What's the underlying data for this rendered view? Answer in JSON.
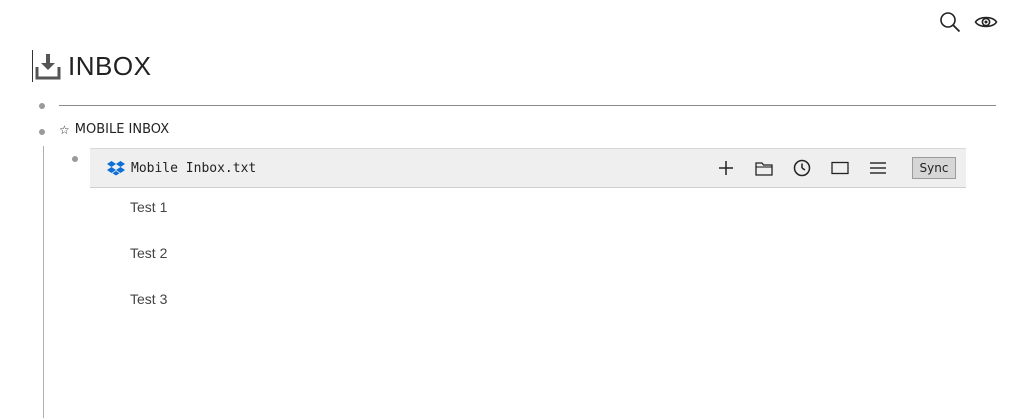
{
  "toolbar": {
    "icons": [
      "search-icon",
      "eye-icon"
    ]
  },
  "header": {
    "title": "INBOX",
    "icon": "inbox-download-icon"
  },
  "outline": {
    "section": {
      "marker": "☆",
      "label": "MOBILE INBOX"
    }
  },
  "file": {
    "icon": "dropbox-icon",
    "name": "Mobile Inbox.txt",
    "actions": [
      "add-icon",
      "folder-icon",
      "clock-icon",
      "rectangle-icon",
      "menu-icon"
    ],
    "sync_label": "Sync",
    "lines": [
      "Test 1",
      "Test 2",
      "Test 3"
    ]
  },
  "colors": {
    "dropbox": "#0d6fd6",
    "bar_background": "#efefef",
    "sync_background": "#d6d6d6"
  }
}
